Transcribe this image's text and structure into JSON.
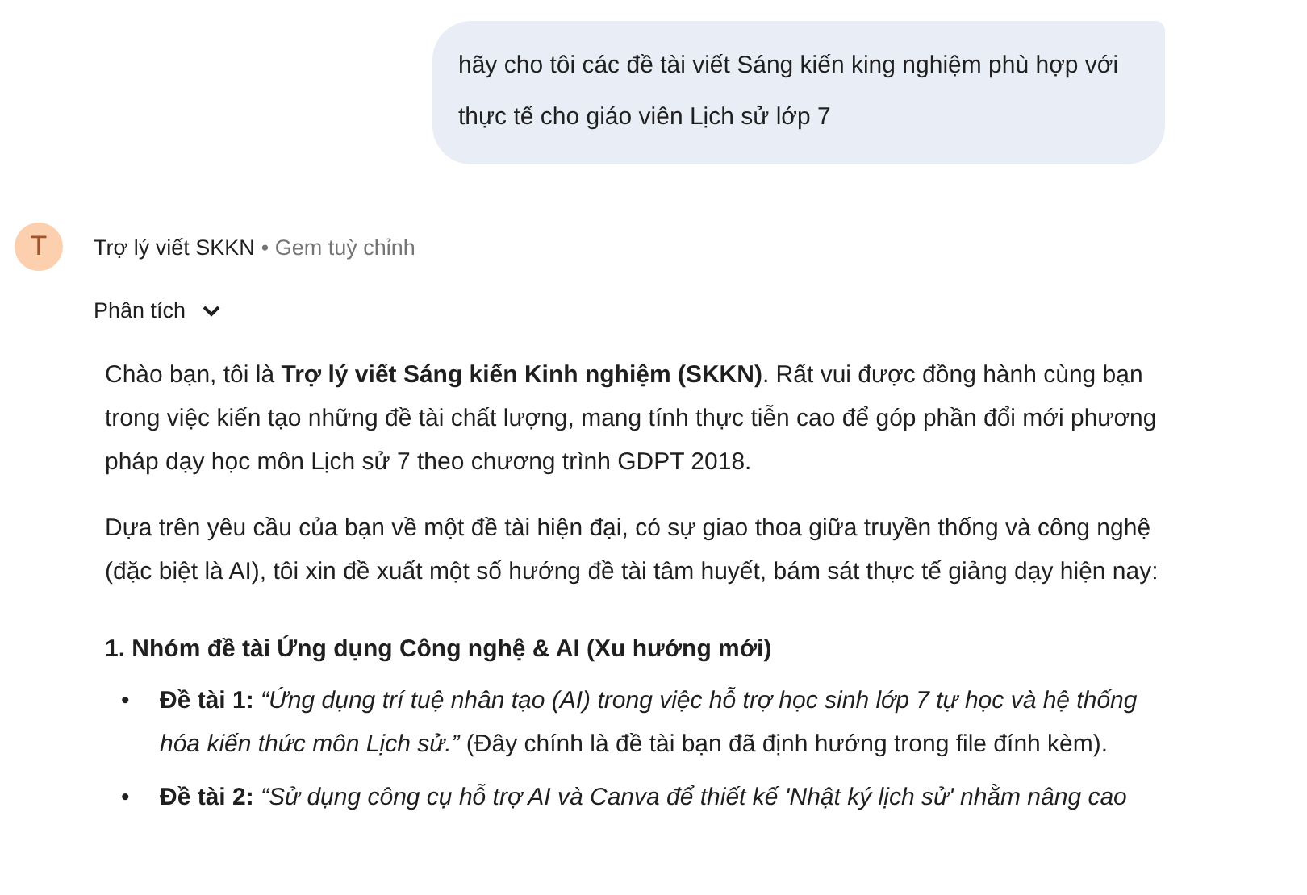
{
  "user_message": "hãy cho tôi các đề tài viết Sáng kiến king nghiệm phù hợp với thực tế cho giáo viên Lịch sử lớp 7",
  "assistant": {
    "avatar_letter": "T",
    "name": "Trợ lý viết SKKN",
    "subtitle": "• Gem tuỳ chỉnh"
  },
  "thinking_toggle": {
    "label": "Phân tích",
    "expanded": false
  },
  "response": [
    {
      "kind": "paragraph",
      "text": "Chào bạn, tôi là **Trợ lý viết Sáng kiến Kinh nghiệm (SKKN)**. Rất vui được đồng hành cùng bạn trong việc kiến tạo những đề tài chất lượng, mang tính thực tiễn cao để góp phần đổi mới phương pháp dạy học môn Lịch sử 7 theo chương trình GDPT 2018."
    },
    {
      "kind": "paragraph",
      "text": "Dựa trên yêu cầu của bạn về một đề tài hiện đại, có sự giao thoa giữa truyền thống và công nghệ (đặc biệt là AI), tôi xin đề xuất một số hướng đề tài tâm huyết, bám sát thực tế giảng dạy hiện nay:"
    },
    {
      "kind": "heading",
      "text": "1. Nhóm đề tài Ứng dụng Công nghệ & AI (Xu hướng mới)"
    },
    {
      "kind": "bullets",
      "items": [
        {
          "bullet": "•",
          "text": "**Đề tài 1:** *“Ứng dụng trí tuệ nhân tạo (AI) trong việc hỗ trợ học sinh lớp 7 tự học và hệ thống hóa kiến thức môn Lịch sử.”* (Đây chính là đề tài bạn đã định hướng trong file đính kèm)."
        },
        {
          "bullet": "•",
          "text": "**Đề tài 2:** *“Sử dụng công cụ hỗ trợ AI và Canva để thiết kế 'Nhật ký lịch sử' nhằm nâng cao*"
        }
      ]
    }
  ]
}
